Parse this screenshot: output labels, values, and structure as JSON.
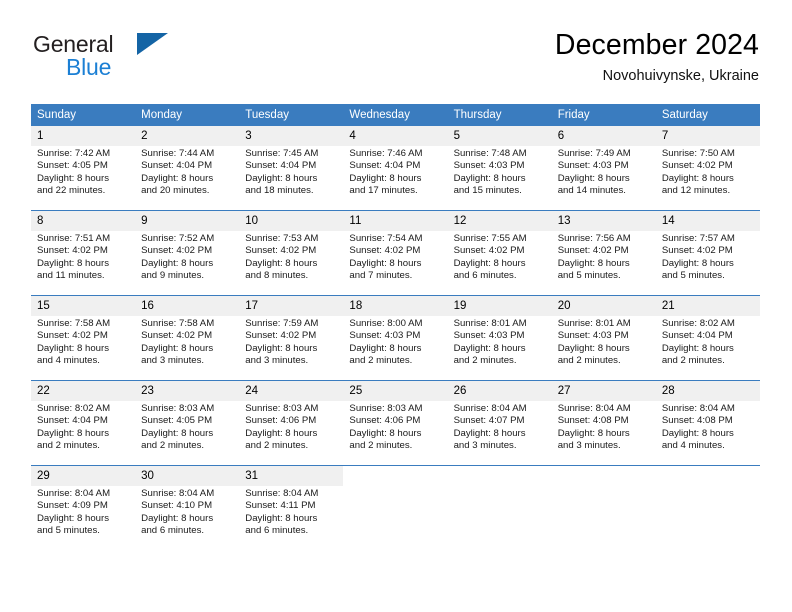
{
  "brand": {
    "name_part1": "General",
    "name_part2": "Blue",
    "flag_icon": "triangle-flag-icon",
    "colors": {
      "dark": "#231f20",
      "blue": "#1b7fd4",
      "flag": "#1464a5"
    }
  },
  "header": {
    "title": "December 2024",
    "location": "Novohuivynske, Ukraine"
  },
  "calendar": {
    "accent_color": "#3a7cbf",
    "daynum_background": "#f0f0f0",
    "weekday_headers": [
      "Sunday",
      "Monday",
      "Tuesday",
      "Wednesday",
      "Thursday",
      "Friday",
      "Saturday"
    ],
    "weeks": [
      [
        {
          "day": "1",
          "sunrise": "Sunrise: 7:42 AM",
          "sunset": "Sunset: 4:05 PM",
          "daylight_line1": "Daylight: 8 hours",
          "daylight_line2": "and 22 minutes."
        },
        {
          "day": "2",
          "sunrise": "Sunrise: 7:44 AM",
          "sunset": "Sunset: 4:04 PM",
          "daylight_line1": "Daylight: 8 hours",
          "daylight_line2": "and 20 minutes."
        },
        {
          "day": "3",
          "sunrise": "Sunrise: 7:45 AM",
          "sunset": "Sunset: 4:04 PM",
          "daylight_line1": "Daylight: 8 hours",
          "daylight_line2": "and 18 minutes."
        },
        {
          "day": "4",
          "sunrise": "Sunrise: 7:46 AM",
          "sunset": "Sunset: 4:04 PM",
          "daylight_line1": "Daylight: 8 hours",
          "daylight_line2": "and 17 minutes."
        },
        {
          "day": "5",
          "sunrise": "Sunrise: 7:48 AM",
          "sunset": "Sunset: 4:03 PM",
          "daylight_line1": "Daylight: 8 hours",
          "daylight_line2": "and 15 minutes."
        },
        {
          "day": "6",
          "sunrise": "Sunrise: 7:49 AM",
          "sunset": "Sunset: 4:03 PM",
          "daylight_line1": "Daylight: 8 hours",
          "daylight_line2": "and 14 minutes."
        },
        {
          "day": "7",
          "sunrise": "Sunrise: 7:50 AM",
          "sunset": "Sunset: 4:02 PM",
          "daylight_line1": "Daylight: 8 hours",
          "daylight_line2": "and 12 minutes."
        }
      ],
      [
        {
          "day": "8",
          "sunrise": "Sunrise: 7:51 AM",
          "sunset": "Sunset: 4:02 PM",
          "daylight_line1": "Daylight: 8 hours",
          "daylight_line2": "and 11 minutes."
        },
        {
          "day": "9",
          "sunrise": "Sunrise: 7:52 AM",
          "sunset": "Sunset: 4:02 PM",
          "daylight_line1": "Daylight: 8 hours",
          "daylight_line2": "and 9 minutes."
        },
        {
          "day": "10",
          "sunrise": "Sunrise: 7:53 AM",
          "sunset": "Sunset: 4:02 PM",
          "daylight_line1": "Daylight: 8 hours",
          "daylight_line2": "and 8 minutes."
        },
        {
          "day": "11",
          "sunrise": "Sunrise: 7:54 AM",
          "sunset": "Sunset: 4:02 PM",
          "daylight_line1": "Daylight: 8 hours",
          "daylight_line2": "and 7 minutes."
        },
        {
          "day": "12",
          "sunrise": "Sunrise: 7:55 AM",
          "sunset": "Sunset: 4:02 PM",
          "daylight_line1": "Daylight: 8 hours",
          "daylight_line2": "and 6 minutes."
        },
        {
          "day": "13",
          "sunrise": "Sunrise: 7:56 AM",
          "sunset": "Sunset: 4:02 PM",
          "daylight_line1": "Daylight: 8 hours",
          "daylight_line2": "and 5 minutes."
        },
        {
          "day": "14",
          "sunrise": "Sunrise: 7:57 AM",
          "sunset": "Sunset: 4:02 PM",
          "daylight_line1": "Daylight: 8 hours",
          "daylight_line2": "and 5 minutes."
        }
      ],
      [
        {
          "day": "15",
          "sunrise": "Sunrise: 7:58 AM",
          "sunset": "Sunset: 4:02 PM",
          "daylight_line1": "Daylight: 8 hours",
          "daylight_line2": "and 4 minutes."
        },
        {
          "day": "16",
          "sunrise": "Sunrise: 7:58 AM",
          "sunset": "Sunset: 4:02 PM",
          "daylight_line1": "Daylight: 8 hours",
          "daylight_line2": "and 3 minutes."
        },
        {
          "day": "17",
          "sunrise": "Sunrise: 7:59 AM",
          "sunset": "Sunset: 4:02 PM",
          "daylight_line1": "Daylight: 8 hours",
          "daylight_line2": "and 3 minutes."
        },
        {
          "day": "18",
          "sunrise": "Sunrise: 8:00 AM",
          "sunset": "Sunset: 4:03 PM",
          "daylight_line1": "Daylight: 8 hours",
          "daylight_line2": "and 2 minutes."
        },
        {
          "day": "19",
          "sunrise": "Sunrise: 8:01 AM",
          "sunset": "Sunset: 4:03 PM",
          "daylight_line1": "Daylight: 8 hours",
          "daylight_line2": "and 2 minutes."
        },
        {
          "day": "20",
          "sunrise": "Sunrise: 8:01 AM",
          "sunset": "Sunset: 4:03 PM",
          "daylight_line1": "Daylight: 8 hours",
          "daylight_line2": "and 2 minutes."
        },
        {
          "day": "21",
          "sunrise": "Sunrise: 8:02 AM",
          "sunset": "Sunset: 4:04 PM",
          "daylight_line1": "Daylight: 8 hours",
          "daylight_line2": "and 2 minutes."
        }
      ],
      [
        {
          "day": "22",
          "sunrise": "Sunrise: 8:02 AM",
          "sunset": "Sunset: 4:04 PM",
          "daylight_line1": "Daylight: 8 hours",
          "daylight_line2": "and 2 minutes."
        },
        {
          "day": "23",
          "sunrise": "Sunrise: 8:03 AM",
          "sunset": "Sunset: 4:05 PM",
          "daylight_line1": "Daylight: 8 hours",
          "daylight_line2": "and 2 minutes."
        },
        {
          "day": "24",
          "sunrise": "Sunrise: 8:03 AM",
          "sunset": "Sunset: 4:06 PM",
          "daylight_line1": "Daylight: 8 hours",
          "daylight_line2": "and 2 minutes."
        },
        {
          "day": "25",
          "sunrise": "Sunrise: 8:03 AM",
          "sunset": "Sunset: 4:06 PM",
          "daylight_line1": "Daylight: 8 hours",
          "daylight_line2": "and 2 minutes."
        },
        {
          "day": "26",
          "sunrise": "Sunrise: 8:04 AM",
          "sunset": "Sunset: 4:07 PM",
          "daylight_line1": "Daylight: 8 hours",
          "daylight_line2": "and 3 minutes."
        },
        {
          "day": "27",
          "sunrise": "Sunrise: 8:04 AM",
          "sunset": "Sunset: 4:08 PM",
          "daylight_line1": "Daylight: 8 hours",
          "daylight_line2": "and 3 minutes."
        },
        {
          "day": "28",
          "sunrise": "Sunrise: 8:04 AM",
          "sunset": "Sunset: 4:08 PM",
          "daylight_line1": "Daylight: 8 hours",
          "daylight_line2": "and 4 minutes."
        }
      ],
      [
        {
          "day": "29",
          "sunrise": "Sunrise: 8:04 AM",
          "sunset": "Sunset: 4:09 PM",
          "daylight_line1": "Daylight: 8 hours",
          "daylight_line2": "and 5 minutes."
        },
        {
          "day": "30",
          "sunrise": "Sunrise: 8:04 AM",
          "sunset": "Sunset: 4:10 PM",
          "daylight_line1": "Daylight: 8 hours",
          "daylight_line2": "and 6 minutes."
        },
        {
          "day": "31",
          "sunrise": "Sunrise: 8:04 AM",
          "sunset": "Sunset: 4:11 PM",
          "daylight_line1": "Daylight: 8 hours",
          "daylight_line2": "and 6 minutes."
        },
        {
          "day": "",
          "sunrise": "",
          "sunset": "",
          "daylight_line1": "",
          "daylight_line2": ""
        },
        {
          "day": "",
          "sunrise": "",
          "sunset": "",
          "daylight_line1": "",
          "daylight_line2": ""
        },
        {
          "day": "",
          "sunrise": "",
          "sunset": "",
          "daylight_line1": "",
          "daylight_line2": ""
        },
        {
          "day": "",
          "sunrise": "",
          "sunset": "",
          "daylight_line1": "",
          "daylight_line2": ""
        }
      ]
    ]
  }
}
